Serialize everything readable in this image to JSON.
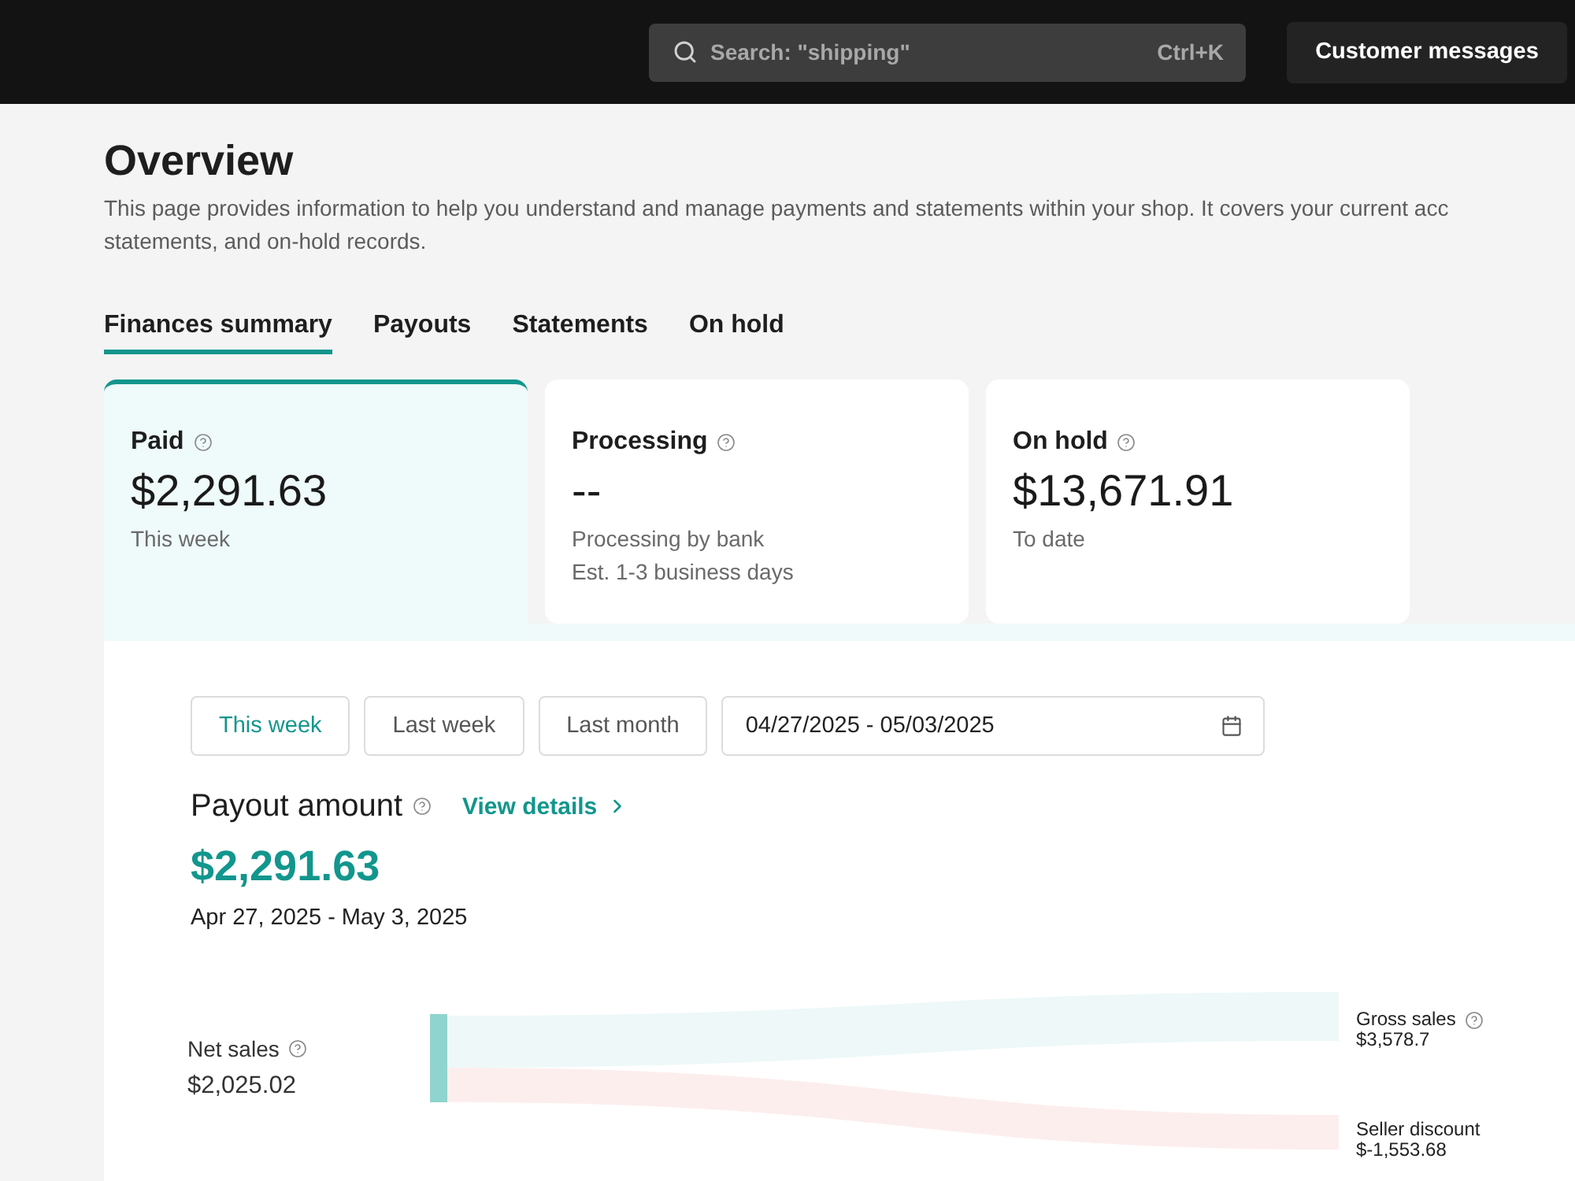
{
  "top_bar": {
    "search": {
      "placeholder": "Search: \"shipping\"",
      "shortcut": "Ctrl+K"
    },
    "button": "Customer messages"
  },
  "page": {
    "title": "Overview",
    "description_lines": [
      "This page provides information to help you understand and manage payments and statements within your shop. It covers your current acc",
      "statements, and on-hold records."
    ]
  },
  "tabs": [
    {
      "label": "Finances summary",
      "selected": true
    },
    {
      "label": "Payouts",
      "selected": false
    },
    {
      "label": "Statements",
      "selected": false
    },
    {
      "label": "On hold",
      "selected": false
    }
  ],
  "summary_cards": [
    {
      "title": "Paid",
      "amount": "$2,291.63",
      "notes": [
        "This week"
      ],
      "selected": true
    },
    {
      "title": "Processing",
      "amount": "--",
      "notes": [
        "Processing by bank",
        "Est. 1-3 business days"
      ],
      "selected": false
    },
    {
      "title": "On hold",
      "amount": "$13,671.91",
      "notes": [
        "To date"
      ],
      "selected": false
    }
  ],
  "payout_panel": {
    "periods": [
      {
        "label": "This week",
        "selected": true
      },
      {
        "label": "Last week",
        "selected": false
      },
      {
        "label": "Last month",
        "selected": false
      }
    ],
    "date_range": "04/27/2025 - 05/03/2025",
    "heading": "Payout amount",
    "link": "View details",
    "amount": "$2,291.63",
    "range_text": "Apr 27, 2025 - May 3, 2025",
    "breakdown": {
      "source": {
        "label": "Net sales",
        "value": "$2,025.02"
      },
      "targets": [
        {
          "label": "Gross sales",
          "value": "$3,578.7",
          "color": "#eef8f8",
          "help": true
        },
        {
          "label": "Seller discount",
          "value": "$-1,553.68",
          "color": "#fdeeee",
          "help": false
        }
      ]
    }
  }
}
